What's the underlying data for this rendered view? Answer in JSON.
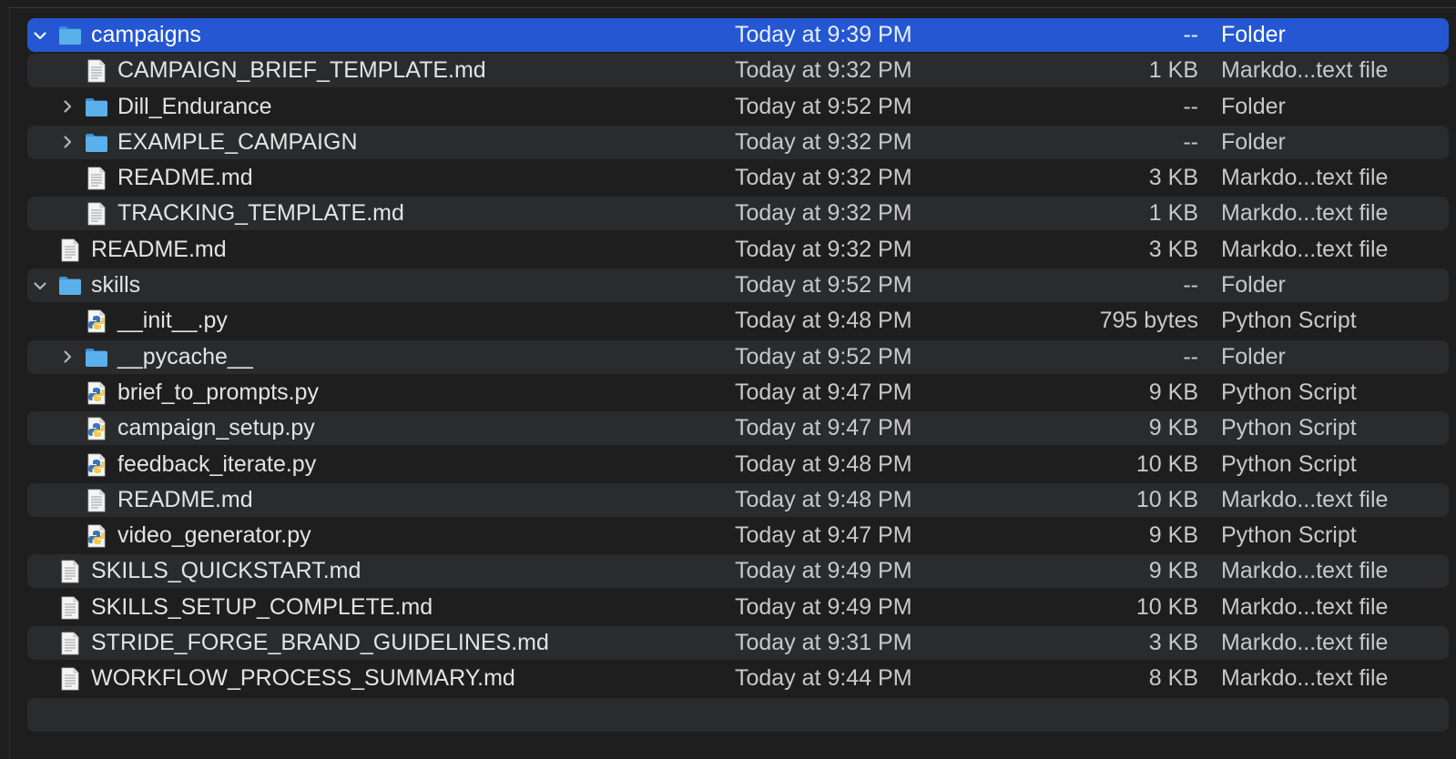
{
  "rows": [
    {
      "name": "campaigns",
      "date": "Today at 9:39 PM",
      "size": "--",
      "kind": "Folder",
      "type": "folder",
      "disclosure": "open",
      "depth": 0,
      "selected": true
    },
    {
      "name": "CAMPAIGN_BRIEF_TEMPLATE.md",
      "date": "Today at 9:32 PM",
      "size": "1 KB",
      "kind": "Markdo...text file",
      "type": "doc",
      "disclosure": "none",
      "depth": 1
    },
    {
      "name": "Dill_Endurance",
      "date": "Today at 9:52 PM",
      "size": "--",
      "kind": "Folder",
      "type": "folder",
      "disclosure": "closed",
      "depth": 1
    },
    {
      "name": "EXAMPLE_CAMPAIGN",
      "date": "Today at 9:32 PM",
      "size": "--",
      "kind": "Folder",
      "type": "folder",
      "disclosure": "closed",
      "depth": 1
    },
    {
      "name": "README.md",
      "date": "Today at 9:32 PM",
      "size": "3 KB",
      "kind": "Markdo...text file",
      "type": "doc",
      "disclosure": "none",
      "depth": 1
    },
    {
      "name": "TRACKING_TEMPLATE.md",
      "date": "Today at 9:32 PM",
      "size": "1 KB",
      "kind": "Markdo...text file",
      "type": "doc",
      "disclosure": "none",
      "depth": 1
    },
    {
      "name": "README.md",
      "date": "Today at 9:32 PM",
      "size": "3 KB",
      "kind": "Markdo...text file",
      "type": "doc",
      "disclosure": "none",
      "depth": 0
    },
    {
      "name": "skills",
      "date": "Today at 9:52 PM",
      "size": "--",
      "kind": "Folder",
      "type": "folder",
      "disclosure": "open",
      "depth": 0
    },
    {
      "name": "__init__.py",
      "date": "Today at 9:48 PM",
      "size": "795 bytes",
      "kind": "Python Script",
      "type": "python",
      "disclosure": "none",
      "depth": 1
    },
    {
      "name": "__pycache__",
      "date": "Today at 9:52 PM",
      "size": "--",
      "kind": "Folder",
      "type": "folder",
      "disclosure": "closed",
      "depth": 1
    },
    {
      "name": "brief_to_prompts.py",
      "date": "Today at 9:47 PM",
      "size": "9 KB",
      "kind": "Python Script",
      "type": "python",
      "disclosure": "none",
      "depth": 1
    },
    {
      "name": "campaign_setup.py",
      "date": "Today at 9:47 PM",
      "size": "9 KB",
      "kind": "Python Script",
      "type": "python",
      "disclosure": "none",
      "depth": 1
    },
    {
      "name": "feedback_iterate.py",
      "date": "Today at 9:48 PM",
      "size": "10 KB",
      "kind": "Python Script",
      "type": "python",
      "disclosure": "none",
      "depth": 1
    },
    {
      "name": "README.md",
      "date": "Today at 9:48 PM",
      "size": "10 KB",
      "kind": "Markdo...text file",
      "type": "doc",
      "disclosure": "none",
      "depth": 1
    },
    {
      "name": "video_generator.py",
      "date": "Today at 9:47 PM",
      "size": "9 KB",
      "kind": "Python Script",
      "type": "python",
      "disclosure": "none",
      "depth": 1
    },
    {
      "name": "SKILLS_QUICKSTART.md",
      "date": "Today at 9:49 PM",
      "size": "9 KB",
      "kind": "Markdo...text file",
      "type": "doc",
      "disclosure": "none",
      "depth": 0
    },
    {
      "name": "SKILLS_SETUP_COMPLETE.md",
      "date": "Today at 9:49 PM",
      "size": "10 KB",
      "kind": "Markdo...text file",
      "type": "doc",
      "disclosure": "none",
      "depth": 0
    },
    {
      "name": "STRIDE_FORGE_BRAND_GUIDELINES.md",
      "date": "Today at 9:31 PM",
      "size": "3 KB",
      "kind": "Markdo...text file",
      "type": "doc",
      "disclosure": "none",
      "depth": 0
    },
    {
      "name": "WORKFLOW_PROCESS_SUMMARY.md",
      "date": "Today at 9:44 PM",
      "size": "8 KB",
      "kind": "Markdo...text file",
      "type": "doc",
      "disclosure": "none",
      "depth": 0
    }
  ],
  "icons": {
    "folder": "folder-icon",
    "doc": "document-icon",
    "python": "python-file-icon",
    "open": "chevron-down-icon",
    "closed": "chevron-right-icon"
  },
  "colors": {
    "selection": "#2457d1",
    "folder": "#4aa3df",
    "row_alt": "#2a2b2d",
    "background": "#1e1e1e"
  }
}
